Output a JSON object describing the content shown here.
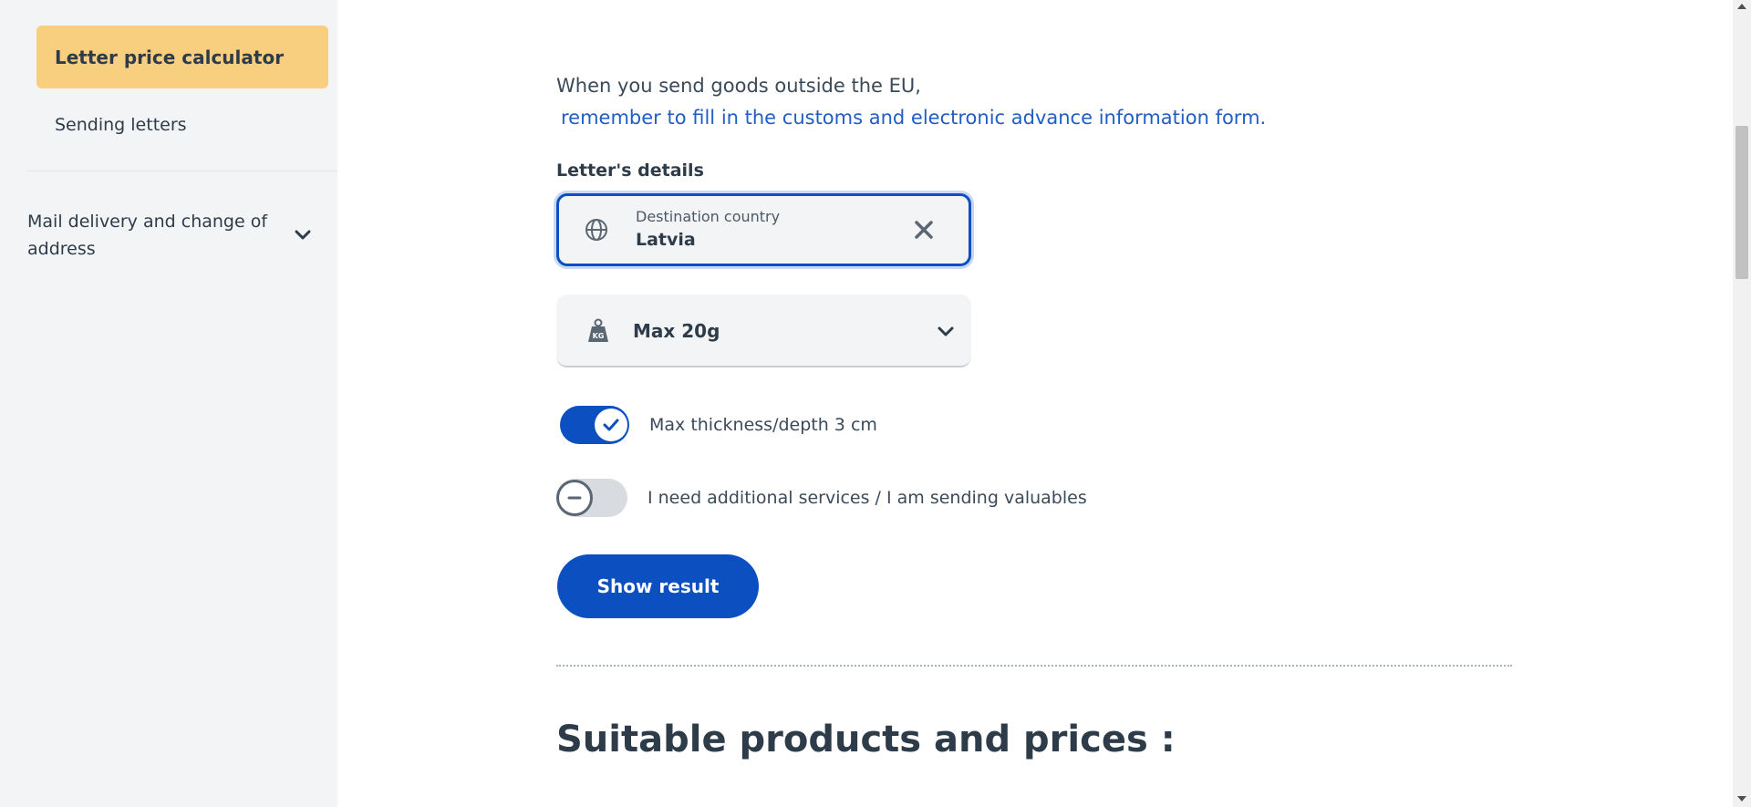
{
  "sidebar": {
    "active_item": "Letter price calculator",
    "items": [
      {
        "label": "Sending letters"
      }
    ],
    "group": {
      "label": "Mail delivery and change of address",
      "icon": "chevron-down-icon"
    }
  },
  "intro": {
    "text": "When you send goods outside the EU,",
    "link": " remember to fill in the customs and electronic advance information form."
  },
  "form": {
    "section_label": "Letter's details",
    "destination": {
      "caption": "Destination country",
      "value": "Latvia",
      "icon": "globe-icon",
      "clear_icon": "close-icon"
    },
    "weight": {
      "value": "Max 20g",
      "icon": "weight-kg-icon",
      "dropdown_icon": "chevron-down-icon"
    },
    "toggles": [
      {
        "label": "Max thickness/depth 3 cm",
        "state": "on"
      },
      {
        "label": "I need additional services / I am sending valuables",
        "state": "off"
      }
    ],
    "submit_label": "Show result"
  },
  "results": {
    "title": "Suitable products and prices :"
  },
  "colors": {
    "accent_blue": "#0b4fc0",
    "active_nav": "#f7cf7e",
    "link": "#1f5fc5",
    "sidebar_bg": "#f3f4f6"
  }
}
